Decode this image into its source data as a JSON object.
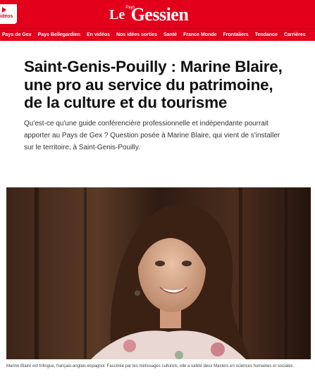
{
  "header": {
    "videos_label": "idéos",
    "logo": {
      "le": "Le",
      "pays": "Pays",
      "gessien": "Gessien"
    }
  },
  "nav": {
    "items": [
      "Pays de Gex",
      "Pays Bellegardien",
      "En vidéos",
      "Nos idées sorties",
      "Santé",
      "France Monde",
      "Frontaliers",
      "Tendance",
      "Carrières"
    ]
  },
  "article": {
    "title": "Saint-Genis-Pouilly : Marine Blaire, une pro au service du patrimoine, de la culture et du tourisme",
    "lead": "Qu'est-ce qu'une guide conférencière professionnelle et indépendante pourrait apporter au Pays de Gex ? Question posée à Marine Blaire, qui vient de s'installer sur le territoire, à Saint-Genis-Pouilly.",
    "caption": "Marine Blaire est trilingue, français-anglais-espagnol. Fascinée par les métissages culturels, elle a validé deux Masters en sciences humaines et sociales."
  },
  "colors": {
    "brand_red": "#e3001b",
    "photo_background": "#2a1a12"
  }
}
